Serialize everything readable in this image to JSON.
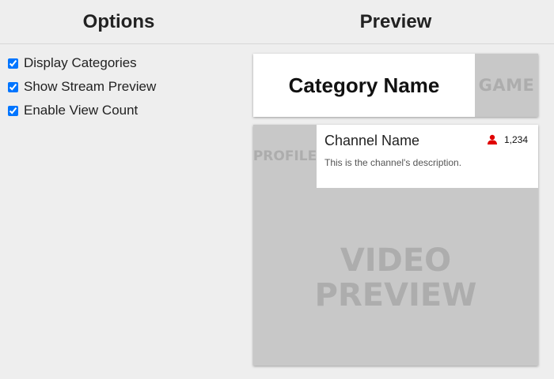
{
  "headers": {
    "options": "Options",
    "preview": "Preview"
  },
  "options": [
    {
      "label": "Display Categories",
      "checked": true
    },
    {
      "label": "Show Stream Preview",
      "checked": true
    },
    {
      "label": "Enable View Count",
      "checked": true
    }
  ],
  "preview": {
    "category": {
      "name": "Category Name",
      "game_placeholder": "GAME"
    },
    "stream": {
      "profile_placeholder": "PROFILE",
      "channel_name": "Channel Name",
      "description": "This is the channel's description.",
      "viewer_count": "1,234",
      "viewer_icon": "user-icon",
      "video_placeholder_line1": "VIDEO",
      "video_placeholder_line2": "PREVIEW"
    }
  },
  "colors": {
    "background": "#eeeeee",
    "card_white": "#ffffff",
    "placeholder_gray": "#c8c8c8",
    "placeholder_text": "#adadad",
    "viewer_icon_red": "#e00000"
  }
}
